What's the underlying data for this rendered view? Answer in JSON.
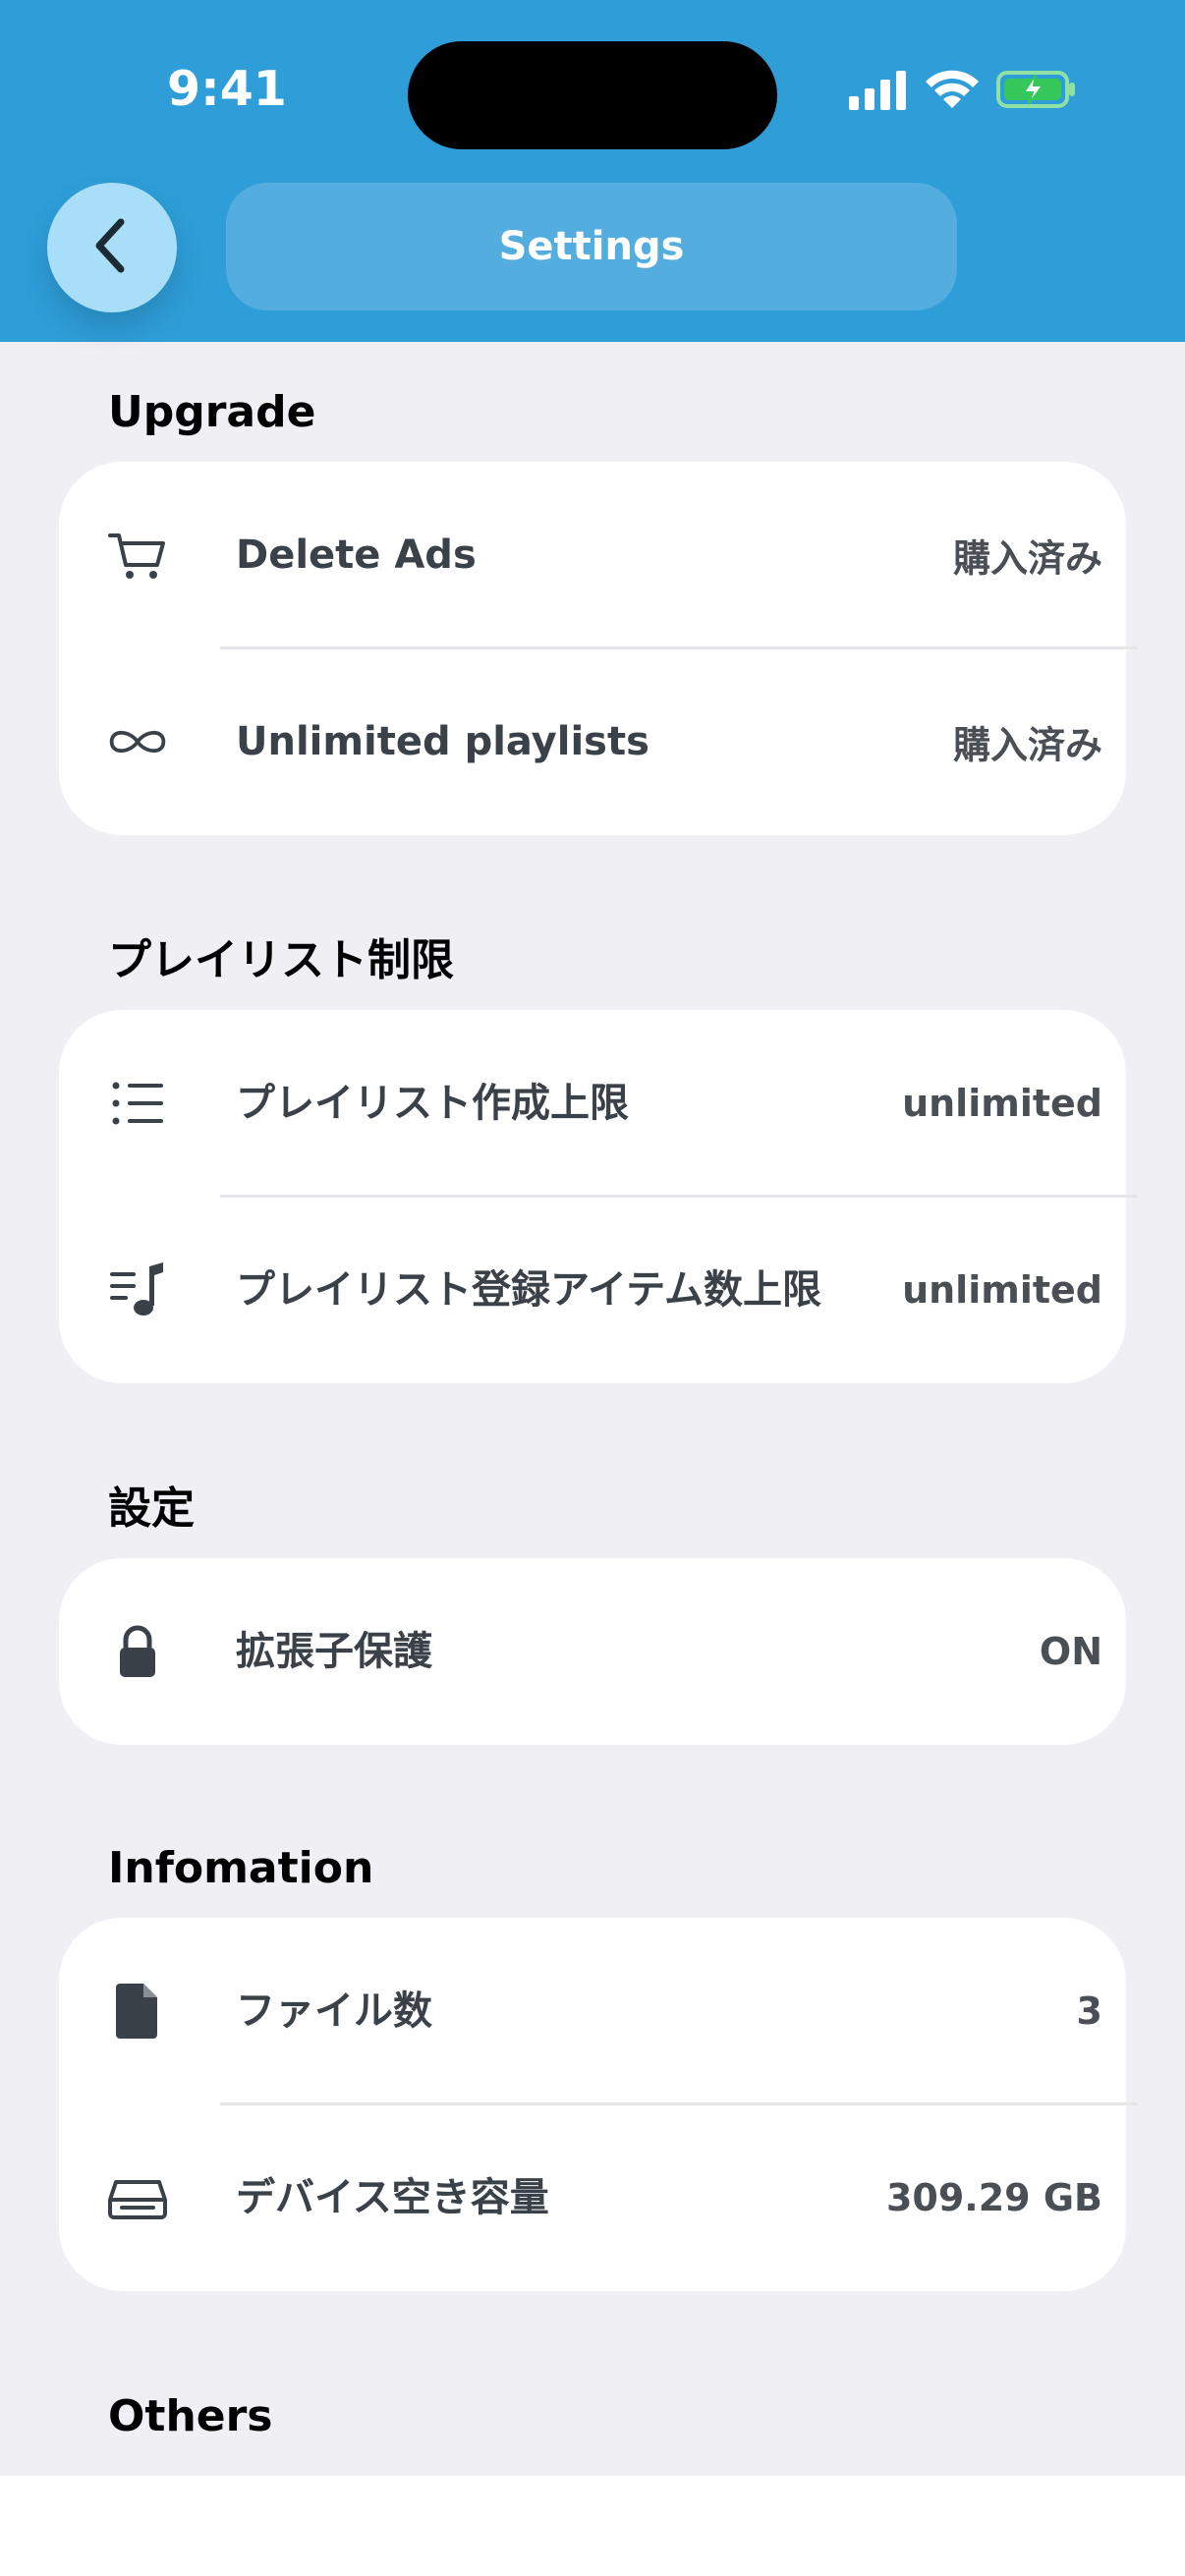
{
  "status_bar": {
    "time": "9:41"
  },
  "header": {
    "title": "Settings",
    "back_icon": "chevron-left-icon"
  },
  "sections": {
    "upgrade": {
      "title": "Upgrade",
      "rows": [
        {
          "icon": "cart-icon",
          "label": "Delete Ads",
          "value": "購入済み"
        },
        {
          "icon": "infinity-icon",
          "label": "Unlimited playlists",
          "value": "購入済み"
        }
      ]
    },
    "playlist_limit": {
      "title": "プレイリスト制限",
      "rows": [
        {
          "icon": "list-icon",
          "label": "プレイリスト作成上限",
          "value": "unlimited"
        },
        {
          "icon": "music-list-icon",
          "label": "プレイリスト登録アイテム数上限",
          "value": "unlimited"
        }
      ]
    },
    "settings": {
      "title": "設定",
      "rows": [
        {
          "icon": "lock-icon",
          "label": "拡張子保護",
          "value": "ON"
        }
      ]
    },
    "information": {
      "title": "Infomation",
      "rows": [
        {
          "icon": "file-icon",
          "label": "ファイル数",
          "value": "3"
        },
        {
          "icon": "drive-icon",
          "label": "デバイス空き容量",
          "value": "309.29 GB"
        }
      ]
    },
    "others": {
      "title": "Others"
    }
  },
  "colors": {
    "header_bg": "#2E9DD8",
    "page_bg": "#EFEFF4",
    "text_primary": "#3B4148",
    "battery_fill": "#35C759"
  }
}
